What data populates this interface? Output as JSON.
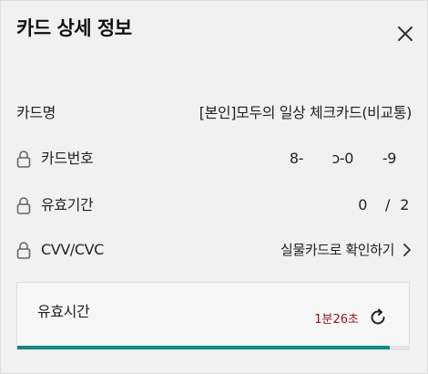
{
  "dialog": {
    "title": "카드 상세 정보",
    "close_icon": "close-icon"
  },
  "details": {
    "card_name_label": "카드명",
    "card_name_value": "[본인]모두의 일상 체크카드(비교통)",
    "card_number_label": "카드번호",
    "card_number_parts": [
      "8-",
      "ɔ-0",
      "-9"
    ],
    "expiry_label": "유효기간",
    "expiry_month": "0",
    "expiry_separator": "/",
    "expiry_year": "2",
    "cvv_label": "CVV/CVC",
    "cvv_link_text": "실물카드로 확인하기"
  },
  "timer": {
    "label": "유효시간",
    "remaining": "1분26초",
    "progress_fraction": 0.95
  },
  "colors": {
    "accent": "#0f8a86",
    "timer_text": "#8b1a1a"
  }
}
